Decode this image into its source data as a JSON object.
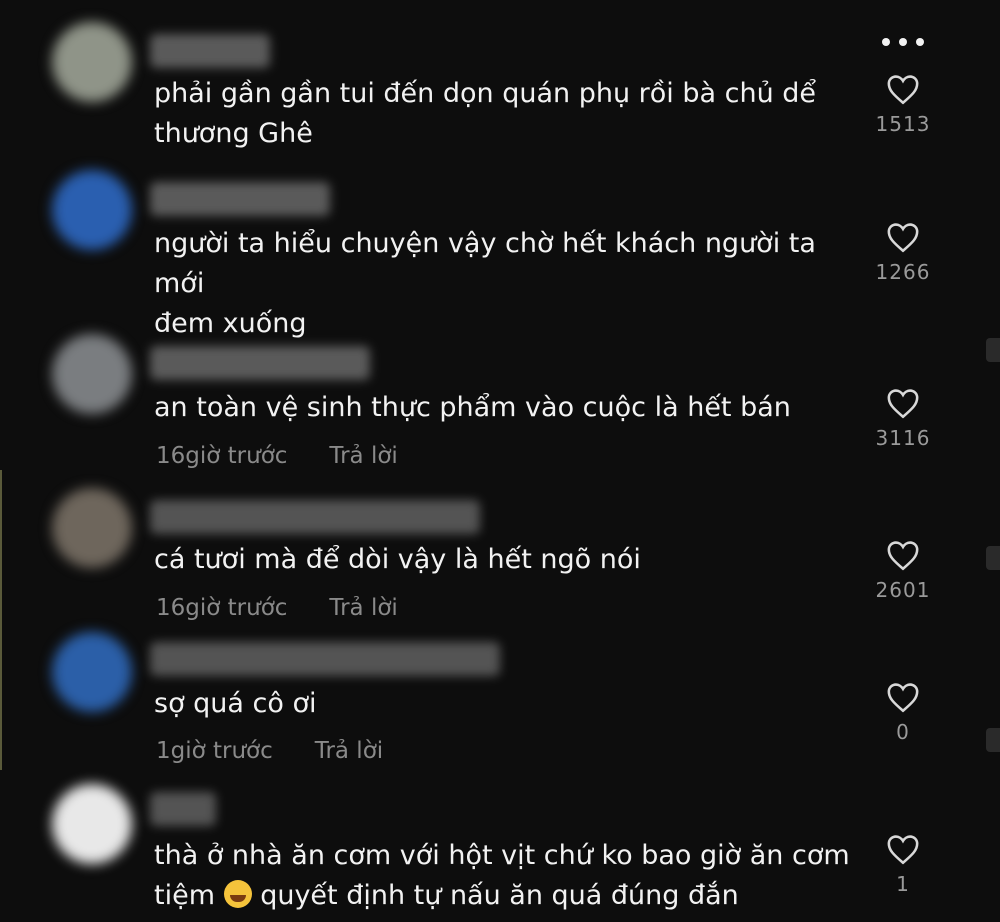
{
  "menu": {
    "icon": "more-horizontal-icon"
  },
  "comments": [
    {
      "text_line1": "phải gần gần tui đến dọn quán phụ rồi bà chủ dể",
      "text_line2": "thương Ghê",
      "likes": "1513",
      "avatar_color": "#8f9488"
    },
    {
      "text_line1": "người ta hiểu chuyện vậy chờ hết khách người ta mới",
      "text_line2": "đem xuống",
      "likes": "1266",
      "avatar_color": "#2a5fb0"
    },
    {
      "text_line1": "an toàn vệ sinh thực phẩm vào cuộc là hết bán",
      "time": "16giờ trước",
      "reply": "Trả lời",
      "likes": "3116",
      "avatar_color": "#7a7d80"
    },
    {
      "text_line1": "cá tươi mà để dòi vậy là hết ngõ nói",
      "time": "16giờ trước",
      "reply": "Trả lời",
      "likes": "2601",
      "avatar_color": "#6e665c"
    },
    {
      "text_line1": "sợ quá cô ơi",
      "time": "1giờ trước",
      "reply": "Trả lời",
      "likes": "0",
      "avatar_color": "#2b5fa8"
    },
    {
      "text_line1": "thà ở nhà ăn cơm với hột vịt chứ ko bao giờ ăn cơm",
      "text_line2_before": "tiệm",
      "emoji": "😅",
      "text_line2_after": "quyết định tự nấu ăn quá đúng đắn",
      "likes": "1",
      "avatar_color": "#e8e8e8"
    }
  ]
}
